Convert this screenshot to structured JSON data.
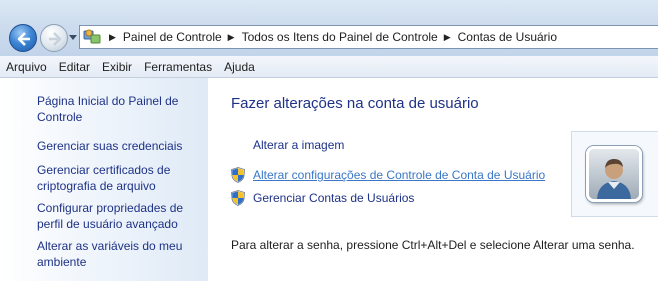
{
  "address": {
    "breadcrumbs": [
      "Painel de Controle",
      "Todos os Itens do Painel de Controle",
      "Contas de Usuário"
    ],
    "icon": "control-panel-icon"
  },
  "menu": {
    "items": [
      "Arquivo",
      "Editar",
      "Exibir",
      "Ferramentas",
      "Ajuda"
    ]
  },
  "sidebar": {
    "items": [
      {
        "label": "Página Inicial do Painel de Controle"
      },
      {
        "label": "Gerenciar suas credenciais"
      },
      {
        "label": "Gerenciar certificados de criptografia de arquivo"
      },
      {
        "label": "Configurar propriedades de perfil de usuário avançado"
      },
      {
        "label": "Alterar as variáveis do meu ambiente"
      }
    ]
  },
  "main": {
    "title": "Fazer alterações na conta de usuário",
    "links": [
      {
        "label": "Alterar a imagem",
        "icon": null
      },
      {
        "label": "Alterar configurações de Controle de Conta de Usuário",
        "icon": "uac-shield-icon"
      },
      {
        "label": "Gerenciar Contas de Usuários",
        "icon": "uac-shield-icon"
      }
    ],
    "note": "Para alterar a senha, pressione Ctrl+Alt+Del e selecione Alterar uma senha.",
    "avatar_icon": "user-avatar-icon"
  },
  "colors": {
    "link": "#1e3287",
    "link_hover": "#3a77c8",
    "sidebar_gradient_end": "#dfeaf6"
  }
}
